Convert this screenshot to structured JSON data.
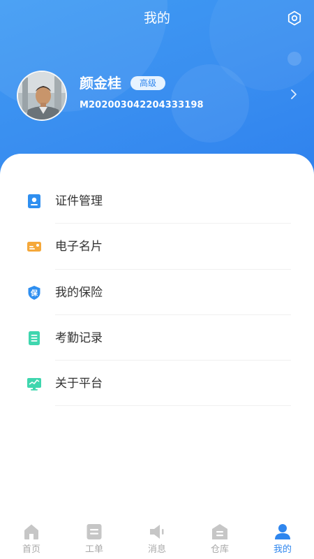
{
  "header": {
    "title": "我的",
    "settings_icon": "settings-icon"
  },
  "profile": {
    "name": "颜金桂",
    "level": "高级",
    "id": "M202003042204333198"
  },
  "menu": [
    {
      "label": "证件管理",
      "icon": "id-card-icon",
      "color": "#2f8ff0"
    },
    {
      "label": "电子名片",
      "icon": "business-card-icon",
      "color": "#f5a83a"
    },
    {
      "label": "我的保险",
      "icon": "insurance-shield-icon",
      "color": "#2f8ff0"
    },
    {
      "label": "考勤记录",
      "icon": "attendance-record-icon",
      "color": "#3fd6ae"
    },
    {
      "label": "关于平台",
      "icon": "about-platform-icon",
      "color": "#3fd6ae"
    }
  ],
  "tabs": [
    {
      "label": "首页",
      "icon": "home-icon",
      "active": false
    },
    {
      "label": "工单",
      "icon": "work-order-icon",
      "active": false
    },
    {
      "label": "消息",
      "icon": "message-icon",
      "active": false
    },
    {
      "label": "仓库",
      "icon": "warehouse-icon",
      "active": false
    },
    {
      "label": "我的",
      "icon": "profile-icon",
      "active": true
    }
  ],
  "colors": {
    "header_bg": "#3a8ff0",
    "accent": "#2f86ee",
    "tab_inactive": "#a9a9a9",
    "text": "#333333"
  }
}
